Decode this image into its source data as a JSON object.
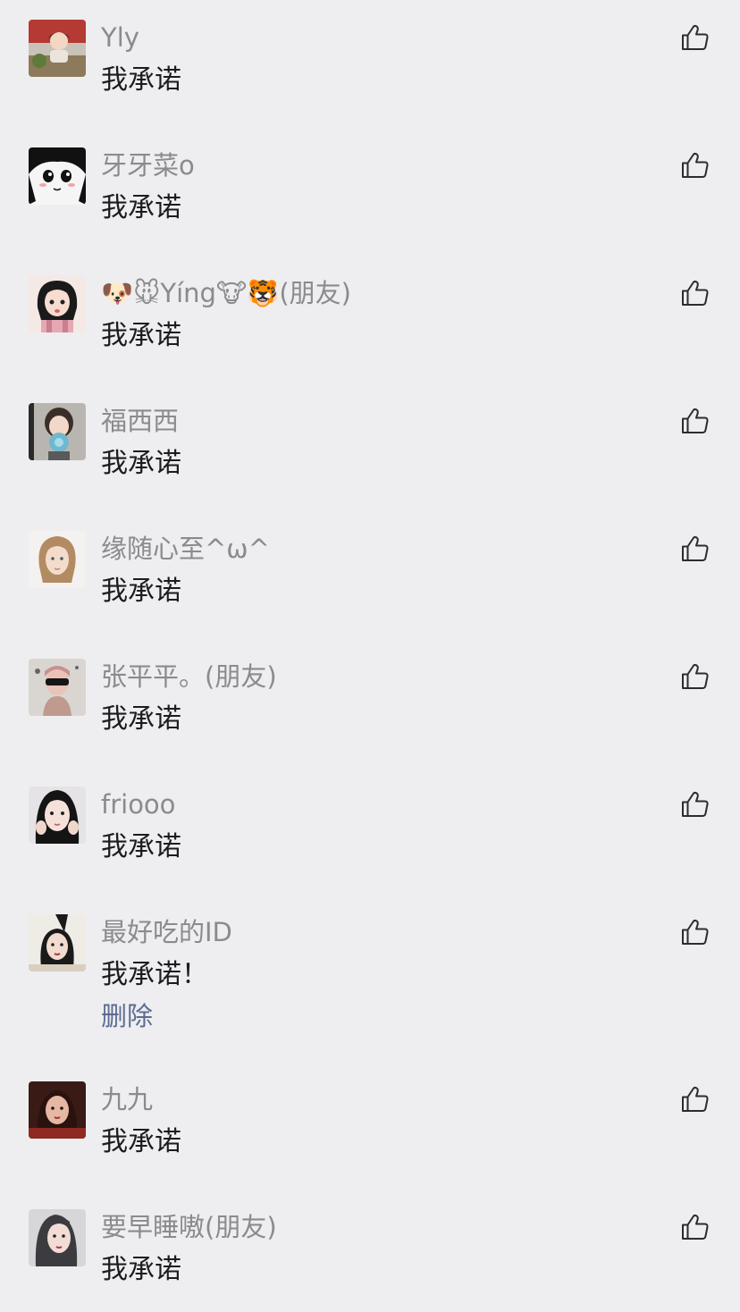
{
  "colors": {
    "background": "#eeeef0",
    "name": "#8a8a8f",
    "comment_text": "#1c1c1e",
    "link": "#5b6b93",
    "like_icon": "#2c2c2e"
  },
  "comments": [
    {
      "name": "Yly",
      "text": "我承诺",
      "avatar": "photo-avatar-icon"
    },
    {
      "name": "牙牙菜o",
      "text": "我承诺",
      "avatar": "anime-girl-avatar-icon"
    },
    {
      "name": "🐶🐭Yíng🐮🐯(朋友)",
      "text": "我承诺",
      "avatar": "cartoon-avatar-icon"
    },
    {
      "name": "福西西",
      "text": "我承诺",
      "avatar": "photo-avatar-icon"
    },
    {
      "name": "缘随心至^ω^",
      "text": "我承诺",
      "avatar": "portrait-avatar-icon"
    },
    {
      "name": "张平平。(朋友)",
      "text": "我承诺",
      "avatar": "photo-avatar-icon"
    },
    {
      "name": "friooo",
      "text": "我承诺",
      "avatar": "portrait-avatar-icon"
    },
    {
      "name": "最好吃的ID",
      "text": "我承诺！",
      "avatar": "portrait-avatar-icon",
      "action": "删除"
    },
    {
      "name": "九九",
      "text": "我承诺",
      "avatar": "portrait-avatar-icon"
    },
    {
      "name": "要早睡嗷(朋友)",
      "text": "我承诺",
      "avatar": "portrait-avatar-icon"
    }
  ],
  "icons": {
    "like": "thumbs-up-icon"
  }
}
